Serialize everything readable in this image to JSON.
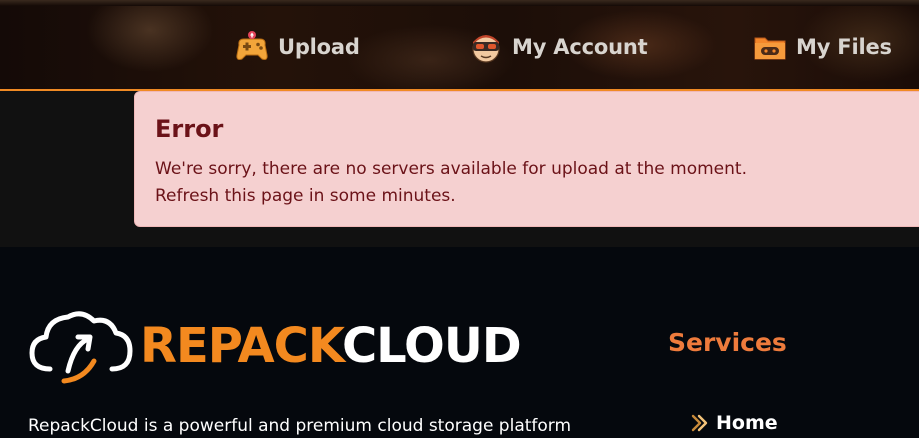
{
  "nav": {
    "items": [
      {
        "label": "Upload",
        "icon": "gamepad-upload-icon"
      },
      {
        "label": "My Account",
        "icon": "goggles-avatar-icon"
      },
      {
        "label": "My Files",
        "icon": "folder-gamepad-icon"
      }
    ]
  },
  "alert": {
    "title": "Error",
    "line_1": "We're sorry, there are no servers available for upload at the moment.",
    "line_2": "Refresh this page in some minutes."
  },
  "footer": {
    "logo": {
      "part_1": "REPACK",
      "part_2": "CLOUD",
      "icon": "cloud-upload-logo-icon"
    },
    "description": "RepackCloud is a powerful and premium cloud storage platform",
    "services": {
      "heading": "Services",
      "links": [
        {
          "label": "Home",
          "icon": "double-chevron-right-icon"
        }
      ]
    }
  },
  "colors": {
    "accent_orange": "#f08a24",
    "alert_bg": "#f5d0d0",
    "alert_text": "#6b1218",
    "footer_bg": "#05080d",
    "services_heading": "#ee7b3c"
  }
}
